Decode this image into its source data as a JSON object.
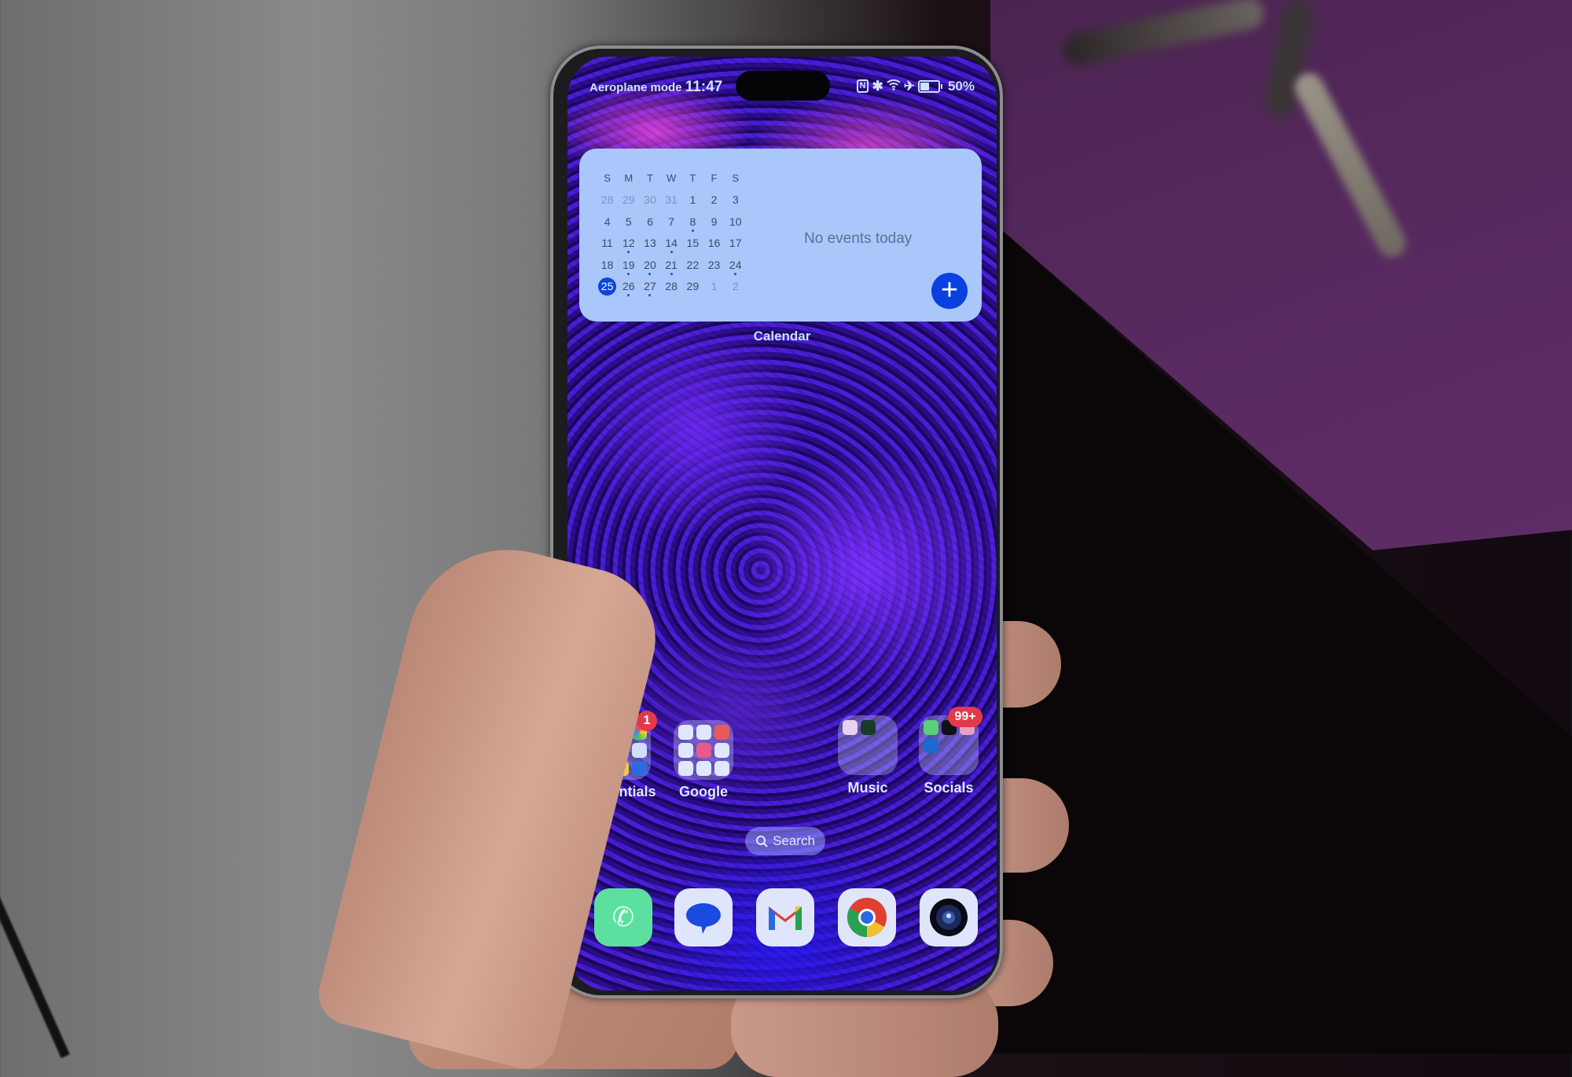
{
  "status_bar": {
    "mode_label": "Aeroplane mode",
    "time": "11:47",
    "icons": [
      "nfc-icon",
      "bluetooth-icon",
      "wifi-icon",
      "airplane-icon",
      "battery-icon"
    ],
    "battery_percent": "50%",
    "battery_level": 0.5
  },
  "calendar_widget": {
    "label": "Calendar",
    "weekday_headers": [
      "S",
      "M",
      "T",
      "W",
      "T",
      "F",
      "S"
    ],
    "weeks": [
      [
        {
          "d": "28",
          "dim": true
        },
        {
          "d": "29",
          "dim": true
        },
        {
          "d": "30",
          "dim": true
        },
        {
          "d": "31",
          "dim": true
        },
        {
          "d": "1"
        },
        {
          "d": "2"
        },
        {
          "d": "3"
        }
      ],
      [
        {
          "d": "4"
        },
        {
          "d": "5"
        },
        {
          "d": "6"
        },
        {
          "d": "7"
        },
        {
          "d": "8",
          "dot": true
        },
        {
          "d": "9"
        },
        {
          "d": "10"
        }
      ],
      [
        {
          "d": "11"
        },
        {
          "d": "12",
          "dot": true
        },
        {
          "d": "13"
        },
        {
          "d": "14",
          "dot": true
        },
        {
          "d": "15"
        },
        {
          "d": "16"
        },
        {
          "d": "17"
        }
      ],
      [
        {
          "d": "18"
        },
        {
          "d": "19",
          "dot": true
        },
        {
          "d": "20",
          "dot": true
        },
        {
          "d": "21",
          "dot": true
        },
        {
          "d": "22"
        },
        {
          "d": "23"
        },
        {
          "d": "24",
          "dot": true
        }
      ],
      [
        {
          "d": "25",
          "today": true
        },
        {
          "d": "26",
          "dot": true
        },
        {
          "d": "27",
          "dot": true
        },
        {
          "d": "28"
        },
        {
          "d": "29"
        },
        {
          "d": "1",
          "dim": true
        },
        {
          "d": "2",
          "dim": true
        }
      ]
    ],
    "empty_message": "No events today",
    "add_button": "+",
    "accent_color": "#0a3fe0"
  },
  "folders": [
    {
      "name": "Essentials",
      "badge": "1",
      "apps": [
        "notes",
        "health",
        "photos",
        "settings",
        "calendar",
        "files",
        "stylus",
        "gallery",
        "security"
      ]
    },
    {
      "name": "Google",
      "badge": "",
      "apps": [
        "google",
        "maps",
        "youtube",
        "drive",
        "youtube-music",
        "wallet",
        "photos-edit",
        "pinwheel",
        "play-store"
      ]
    },
    {
      "name": "Music",
      "badge": "",
      "apps": [
        "youtube-music",
        "spotify"
      ]
    },
    {
      "name": "Socials",
      "badge": "99+",
      "apps": [
        "whatsapp",
        "x",
        "instagram",
        "linkedin"
      ]
    }
  ],
  "search": {
    "label": "Search"
  },
  "dock": [
    {
      "name": "Phone"
    },
    {
      "name": "Messages"
    },
    {
      "name": "Gmail"
    },
    {
      "name": "Chrome"
    },
    {
      "name": "Camera"
    }
  ]
}
